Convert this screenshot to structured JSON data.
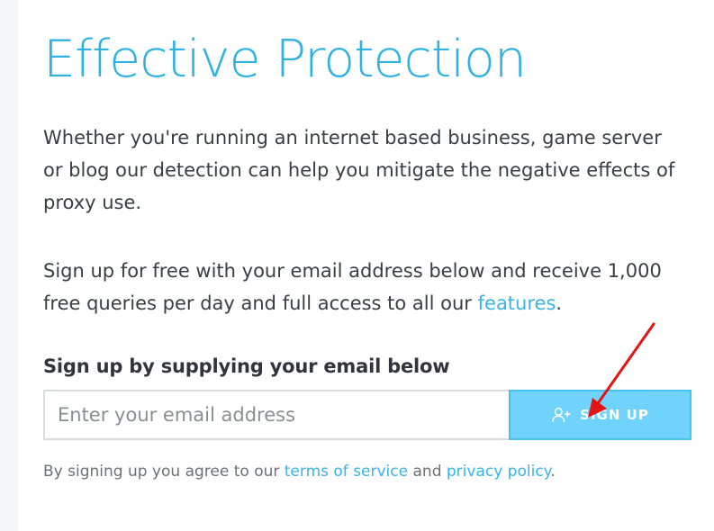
{
  "heading": {
    "title": "Effective Protection"
  },
  "intro": {
    "paragraph1": "Whether you're running an internet based business, game server or blog our detection can help you mitigate the negative effects of proxy use.",
    "paragraph2_before_link": "Sign up for free with your email address below and receive 1,000 free queries per day and full access to all our ",
    "paragraph2_link": "features",
    "paragraph2_after_link": "."
  },
  "signup": {
    "heading": "Sign up by supplying your email below",
    "email_placeholder": "Enter your email address",
    "button_label": "SIGN UP",
    "button_icon": "user-plus-icon",
    "agreement_before_terms": "By signing up you agree to our ",
    "terms_link": "terms of service",
    "agreement_middle": " and ",
    "privacy_link": "privacy policy",
    "agreement_end": "."
  },
  "annotation": {
    "arrow_color": "#e31414"
  },
  "colors": {
    "accent": "#2fb2e2",
    "button": "#6fd3fb",
    "text": "#3a3d45",
    "muted_text": "#6d7078"
  }
}
